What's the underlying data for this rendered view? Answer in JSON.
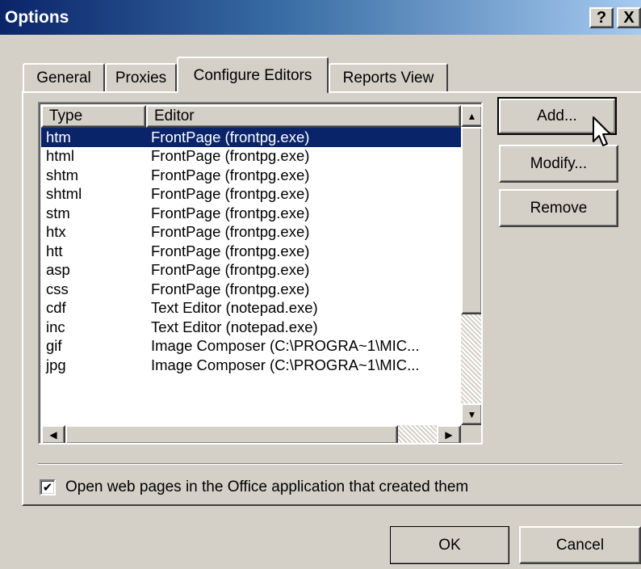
{
  "window": {
    "title": "Options",
    "help_label": "?",
    "close_label": "X"
  },
  "tabs": [
    {
      "label": "General",
      "active": false
    },
    {
      "label": "Proxies",
      "active": false
    },
    {
      "label": "Configure Editors",
      "active": true
    },
    {
      "label": "Reports View",
      "active": false
    }
  ],
  "editors_list": {
    "columns": [
      "Type",
      "Editor"
    ],
    "rows": [
      {
        "type": "htm",
        "editor": "FrontPage (frontpg.exe)",
        "selected": true
      },
      {
        "type": "html",
        "editor": "FrontPage (frontpg.exe)"
      },
      {
        "type": "shtm",
        "editor": "FrontPage (frontpg.exe)"
      },
      {
        "type": "shtml",
        "editor": "FrontPage (frontpg.exe)"
      },
      {
        "type": "stm",
        "editor": "FrontPage (frontpg.exe)"
      },
      {
        "type": "htx",
        "editor": "FrontPage (frontpg.exe)"
      },
      {
        "type": "htt",
        "editor": "FrontPage (frontpg.exe)"
      },
      {
        "type": "asp",
        "editor": "FrontPage (frontpg.exe)"
      },
      {
        "type": "css",
        "editor": "FrontPage (frontpg.exe)"
      },
      {
        "type": "cdf",
        "editor": "Text Editor (notepad.exe)"
      },
      {
        "type": "inc",
        "editor": "Text Editor (notepad.exe)"
      },
      {
        "type": "gif",
        "editor": "Image Composer (C:\\PROGRA~1\\MIC..."
      },
      {
        "type": "jpg",
        "editor": "Image Composer (C:\\PROGRA~1\\MIC..."
      }
    ]
  },
  "buttons": {
    "add": "Add...",
    "modify": "Modify...",
    "remove": "Remove",
    "ok": "OK",
    "cancel": "Cancel"
  },
  "options": {
    "open_in_office_label": "Open web pages in the Office application that created them",
    "open_in_office_checked": true
  },
  "icons": {
    "scroll_up": "▲",
    "scroll_down": "▼",
    "scroll_left": "◀",
    "scroll_right": "▶",
    "check": "✔"
  },
  "colors": {
    "title_start": "#0a246a",
    "title_end": "#a6caf0",
    "selection": "#0a246a",
    "face": "#d4d0c8"
  }
}
